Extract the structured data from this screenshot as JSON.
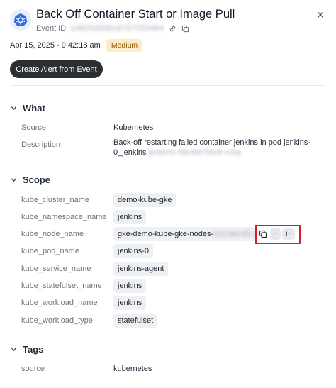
{
  "header": {
    "title": "Back Off Container Start or Image Pull",
    "event_id_label": "Event ID",
    "event_id_value": "14625350816707253464",
    "close_glyph": "×"
  },
  "meta": {
    "date": "Apr 15, 2025 - 9:42:18 am",
    "severity": "Medium"
  },
  "actions": {
    "create_alert": "Create Alert from Event"
  },
  "what": {
    "heading": "What",
    "source_label": "Source",
    "source_value": "Kubernetes",
    "description_label": "Description",
    "description_value": "Back-off restarting failed container jenkins in pod jenkins-0_jenkins",
    "description_blur": "jenkins-5bc8d7f4c9-x2lq"
  },
  "scope": {
    "heading": "Scope",
    "rows": [
      {
        "label": "kube_cluster_name",
        "value": "demo-kube-gke"
      },
      {
        "label": "kube_namespace_name",
        "value": "jenkins"
      },
      {
        "label": "kube_node_name",
        "value": "gke-demo-kube-gke-nodes-",
        "value_blur": "1013ec45-avcf"
      },
      {
        "label": "kube_pod_name",
        "value": "jenkins-0"
      },
      {
        "label": "kube_service_name",
        "value": "jenkins-agent"
      },
      {
        "label": "kube_statefulset_name",
        "value": "jenkins"
      },
      {
        "label": "kube_workload_name",
        "value": "jenkins"
      },
      {
        "label": "kube_workload_type",
        "value": "statefulset"
      }
    ],
    "filter_eq": "=",
    "filter_neq": "!="
  },
  "tags": {
    "heading": "Tags",
    "source_label": "source",
    "source_value": "kubernetes"
  },
  "colors": {
    "primary_button": "#2b2f33",
    "badge_bg": "#fdecc8",
    "highlight": "#d42020"
  }
}
